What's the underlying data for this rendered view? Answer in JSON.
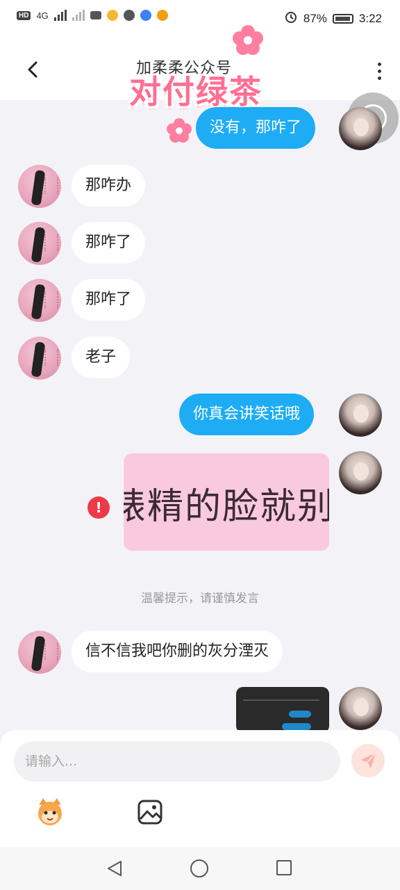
{
  "status_bar": {
    "left_indicators": [
      "HD",
      "4G"
    ],
    "battery": "87%",
    "time": "3:22"
  },
  "header": {
    "title": "加柔柔公众号",
    "back_icon": "chevron-left-icon",
    "more_icon": "more-vertical-icon"
  },
  "overlay": {
    "title": "对付绿茶"
  },
  "messages": [
    {
      "side": "out",
      "text": "没有，那咋了"
    },
    {
      "side": "in",
      "text": "那咋办"
    },
    {
      "side": "in",
      "text": "那咋了"
    },
    {
      "side": "in",
      "text": "那咋了"
    },
    {
      "side": "in",
      "text": "老子"
    },
    {
      "side": "out",
      "text": "你真会讲笑话哦"
    },
    {
      "side": "out",
      "type": "sticker",
      "text": "婊精的脸就别惯",
      "status": "failed"
    },
    {
      "side": "in",
      "text": "信不信我吧你删的灰分湮灭"
    },
    {
      "side": "out",
      "type": "image"
    }
  ],
  "system_tip": "温馨提示，请谨慎发言",
  "input": {
    "placeholder": "请输入...",
    "send_icon": "send-icon",
    "emoji_icon": "emoji-icon",
    "image_icon": "image-icon"
  },
  "nav": {
    "back_icon": "nav-back-icon",
    "home_icon": "nav-home-icon",
    "recent_icon": "nav-recent-icon"
  },
  "colors": {
    "outgoing_bubble": "#1eacf4",
    "incoming_bubble": "#ffffff",
    "background": "#f3f3f7",
    "error": "#ee3a46",
    "overlay_title": "#ff6f93"
  }
}
